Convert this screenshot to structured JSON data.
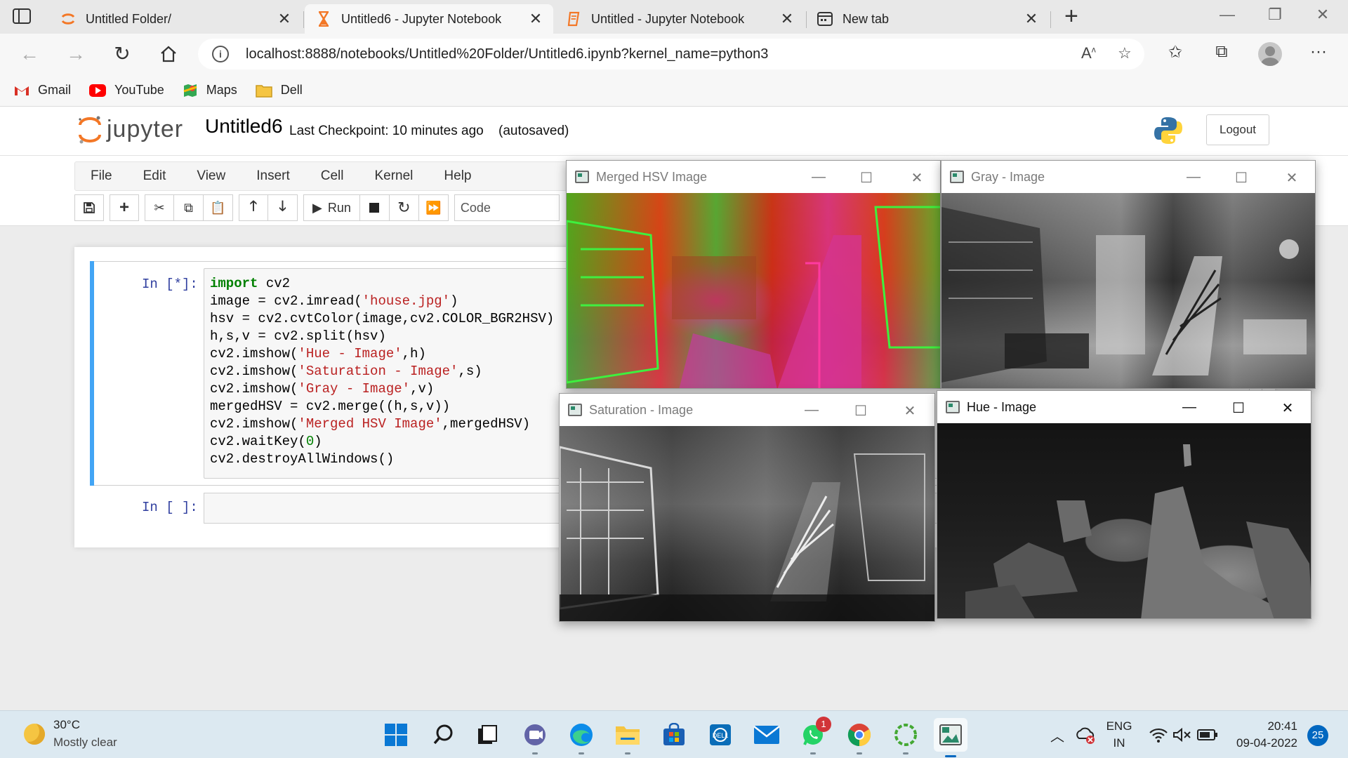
{
  "browser": {
    "tabs": [
      {
        "title": "Untitled Folder/",
        "icon": "jupyter-spinner-icon"
      },
      {
        "title": "Untitled6 - Jupyter Notebook",
        "icon": "hourglass-icon",
        "active": true
      },
      {
        "title": "Untitled - Jupyter Notebook",
        "icon": "notebook-icon"
      },
      {
        "title": "New tab",
        "icon": "new-tab-page-icon"
      }
    ],
    "url": "localhost:8888/notebooks/Untitled%20Folder/Untitled6.ipynb?kernel_name=python3",
    "bookmarks": [
      {
        "label": "Gmail",
        "icon": "gmail-icon"
      },
      {
        "label": "YouTube",
        "icon": "youtube-icon"
      },
      {
        "label": "Maps",
        "icon": "maps-icon"
      },
      {
        "label": "Dell",
        "icon": "folder-icon"
      }
    ]
  },
  "jupyter": {
    "logo_text": "jupyter",
    "notebook_title": "Untitled6",
    "checkpoint": "Last Checkpoint: 10 minutes ago",
    "autosaved": "(autosaved)",
    "logout": "Logout",
    "menu": [
      "File",
      "Edit",
      "View",
      "Insert",
      "Cell",
      "Kernel",
      "Help"
    ],
    "toolbar": {
      "run_label": "Run",
      "cell_type": "Code"
    },
    "cells": [
      {
        "prompt": "In [*]:",
        "code": [
          "import cv2",
          "image = cv2.imread('house.jpg')",
          "hsv = cv2.cvtColor(image,cv2.COLOR_BGR2HSV)",
          "h,s,v = cv2.split(hsv)",
          "cv2.imshow('Hue - Image',h)",
          "cv2.imshow('Saturation - Image',s)",
          "cv2.imshow('Gray - Image',v)",
          "mergedHSV = cv2.merge((h,s,v))",
          "cv2.imshow('Merged HSV Image',mergedHSV)",
          "cv2.waitKey(0)",
          "cv2.destroyAllWindows()"
        ]
      },
      {
        "prompt": "In [ ]:",
        "code": []
      }
    ]
  },
  "cv_windows": {
    "merged": {
      "title": "Merged HSV Image"
    },
    "gray": {
      "title": "Gray - Image"
    },
    "saturation": {
      "title": "Saturation - Image"
    },
    "hue": {
      "title": "Hue - Image"
    }
  },
  "taskbar": {
    "weather_temp": "30°C",
    "weather_desc": "Mostly clear",
    "whatsapp_badge": "1",
    "lang_line1": "ENG",
    "lang_line2": "IN",
    "time": "20:41",
    "date": "09-04-2022",
    "notification_count": "25"
  }
}
